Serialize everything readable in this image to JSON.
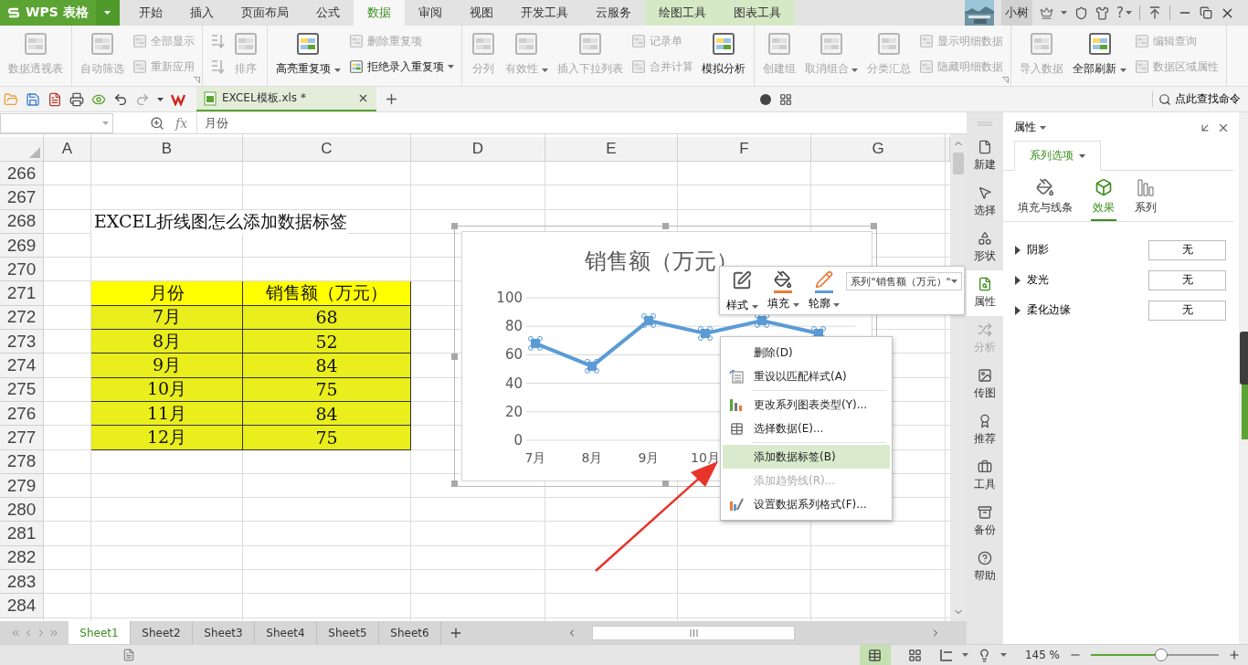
{
  "app_button": {
    "label": "WPS 表格"
  },
  "menu_tabs": [
    {
      "label": "开始",
      "selected": false,
      "kind": "main"
    },
    {
      "label": "插入",
      "selected": false,
      "kind": "main"
    },
    {
      "label": "页面布局",
      "selected": false,
      "kind": "main"
    },
    {
      "label": "公式",
      "selected": false,
      "kind": "main"
    },
    {
      "label": "数据",
      "selected": true,
      "kind": "main"
    },
    {
      "label": "审阅",
      "selected": false,
      "kind": "main"
    },
    {
      "label": "视图",
      "selected": false,
      "kind": "main"
    },
    {
      "label": "开发工具",
      "selected": false,
      "kind": "main"
    },
    {
      "label": "云服务",
      "selected": false,
      "kind": "main"
    },
    {
      "label": "绘图工具",
      "selected": false,
      "kind": "context"
    },
    {
      "label": "图表工具",
      "selected": false,
      "kind": "context"
    }
  ],
  "account": {
    "name": "小树",
    "help": "?"
  },
  "ribbon_groups": [
    {
      "launcher": false,
      "columns": [
        {
          "kind": "large",
          "label": "数据透视表",
          "disabled": true,
          "dropdown": false
        }
      ]
    },
    {
      "launcher": true,
      "columns": [
        {
          "kind": "large",
          "label": "自动筛选",
          "disabled": true,
          "dropdown": false
        },
        {
          "kind": "stack",
          "items": [
            {
              "label": "全部显示",
              "disabled": true,
              "dropdown": false
            },
            {
              "label": "重新应用",
              "disabled": true,
              "dropdown": false
            }
          ]
        }
      ]
    },
    {
      "launcher": false,
      "columns": [
        {
          "kind": "stack",
          "items": [
            {
              "disabled": true,
              "dropdown": false
            },
            {
              "disabled": true,
              "dropdown": false
            }
          ]
        },
        {
          "kind": "large",
          "label": "排序",
          "disabled": true,
          "dropdown": false
        }
      ]
    },
    {
      "launcher": false,
      "columns": [
        {
          "kind": "large",
          "label": "高亮重复项",
          "disabled": false,
          "dropdown": true
        },
        {
          "kind": "stack",
          "items": [
            {
              "label": "删除重复项",
              "disabled": true,
              "dropdown": false
            },
            {
              "label": "拒绝录入重复项",
              "disabled": false,
              "dropdown": true
            }
          ]
        }
      ]
    },
    {
      "launcher": false,
      "columns": [
        {
          "kind": "large",
          "label": "分列",
          "disabled": true,
          "dropdown": false
        },
        {
          "kind": "large",
          "label": "有效性",
          "disabled": true,
          "dropdown": true
        },
        {
          "kind": "large",
          "label": "插入下拉列表",
          "disabled": true,
          "dropdown": false
        },
        {
          "kind": "stack",
          "items": [
            {
              "label": "记录单",
              "disabled": true,
              "dropdown": false
            },
            {
              "label": "合并计算",
              "disabled": true,
              "dropdown": false
            }
          ]
        },
        {
          "kind": "large",
          "label": "模拟分析",
          "disabled": false,
          "dropdown": false
        }
      ]
    },
    {
      "launcher": true,
      "columns": [
        {
          "kind": "large",
          "label": "创建组",
          "disabled": true,
          "dropdown": false
        },
        {
          "kind": "large",
          "label": "取消组合",
          "disabled": true,
          "dropdown": true
        },
        {
          "kind": "large",
          "label": "分类汇总",
          "disabled": true,
          "dropdown": false
        },
        {
          "kind": "stack",
          "items": [
            {
              "label": "显示明细数据",
              "disabled": true,
              "dropdown": false
            },
            {
              "label": "隐藏明细数据",
              "disabled": true,
              "dropdown": false
            }
          ]
        }
      ]
    },
    {
      "launcher": false,
      "columns": [
        {
          "kind": "large",
          "label": "导入数据",
          "disabled": true,
          "dropdown": false
        },
        {
          "kind": "large",
          "label": "全部刷新",
          "disabled": false,
          "dropdown": true
        },
        {
          "kind": "stack",
          "items": [
            {
              "label": "编辑查询",
              "disabled": true,
              "dropdown": false
            },
            {
              "label": "数据区域属性",
              "disabled": true,
              "dropdown": false
            }
          ]
        }
      ]
    }
  ],
  "document_tab": {
    "title": "EXCEL模板.xls *"
  },
  "find_command": {
    "label": "点此查找命令"
  },
  "formula_bar": {
    "fx": "fx",
    "value": "月份"
  },
  "sheet": {
    "columns": [
      "A",
      "B",
      "C",
      "D",
      "E",
      "F",
      "G"
    ],
    "row_numbers": [
      "266",
      "267",
      "268",
      "269",
      "270",
      "271",
      "272",
      "273",
      "274",
      "275",
      "276",
      "277",
      "278",
      "279",
      "280",
      "281",
      "282",
      "283",
      "284"
    ],
    "note": "EXCEL折线图怎么添加数据标签",
    "table": {
      "header": [
        "月份",
        "销售额（万元）"
      ],
      "rows": [
        [
          "7月",
          "68"
        ],
        [
          "8月",
          "52"
        ],
        [
          "9月",
          "84"
        ],
        [
          "10月",
          "75"
        ],
        [
          "11月",
          "84"
        ],
        [
          "12月",
          "75"
        ]
      ]
    }
  },
  "chart": {
    "chart_data": {
      "type": "line",
      "title": "销售额（万元）",
      "categories": [
        "7月",
        "8月",
        "9月",
        "10月",
        null,
        null
      ],
      "series": [
        {
          "color": "#5b9bd5",
          "marker": "square",
          "values": [
            68,
            52,
            84,
            75,
            84,
            75
          ]
        }
      ],
      "ylim": [
        0,
        100
      ],
      "yticks": [
        0,
        20,
        40,
        60,
        80,
        100
      ],
      "grid": true
    }
  },
  "chart_toolbar": {
    "buttons": [
      {
        "label": "样式"
      },
      {
        "label": "填充"
      },
      {
        "label": "轮廓"
      }
    ],
    "series_select": "系列\"销售额（万元）\""
  },
  "context_menu": [
    {
      "kind": "item",
      "label": "删除(D)",
      "selected": false,
      "disabled": false
    },
    {
      "kind": "item",
      "label": "重设以匹配样式(A)",
      "selected": false,
      "disabled": false
    },
    {
      "kind": "separator"
    },
    {
      "kind": "item",
      "label": "更改系列图表类型(Y)...",
      "selected": false,
      "disabled": false
    },
    {
      "kind": "item",
      "label": "选择数据(E)...",
      "selected": false,
      "disabled": false
    },
    {
      "kind": "separator"
    },
    {
      "kind": "item",
      "label": "添加数据标签(B)",
      "selected": true,
      "disabled": false
    },
    {
      "kind": "item",
      "label": "添加趋势线(R)...",
      "selected": false,
      "disabled": true
    },
    {
      "kind": "item",
      "label": "设置数据系列格式(F)...",
      "selected": false,
      "disabled": false
    }
  ],
  "side_bar": [
    {
      "label": "新建",
      "selected": false,
      "disabled": false
    },
    {
      "label": "选择",
      "selected": false,
      "disabled": false
    },
    {
      "label": "形状",
      "selected": false,
      "disabled": false
    },
    {
      "label": "属性",
      "selected": true,
      "disabled": false
    },
    {
      "label": "分析",
      "selected": false,
      "disabled": true
    },
    {
      "label": "传图",
      "selected": false,
      "disabled": false
    },
    {
      "label": "推荐",
      "selected": false,
      "disabled": false
    },
    {
      "label": "工具",
      "selected": false,
      "disabled": false
    },
    {
      "label": "备份",
      "selected": false,
      "disabled": false
    },
    {
      "label": "帮助",
      "selected": false,
      "disabled": false
    }
  ],
  "properties_panel": {
    "title": "属性",
    "tab": "系列选项",
    "subtabs": [
      {
        "label": "填充与线条",
        "selected": false
      },
      {
        "label": "效果",
        "selected": true
      },
      {
        "label": "系列",
        "selected": false
      }
    ],
    "effects": [
      {
        "label": "阴影",
        "value": "无",
        "expanded": false
      },
      {
        "label": "发光",
        "value": "无",
        "expanded": false
      },
      {
        "label": "柔化边缘",
        "value": "无",
        "expanded": false
      }
    ]
  },
  "sheet_tabs": [
    {
      "label": "Sheet1",
      "selected": true
    },
    {
      "label": "Sheet2",
      "selected": false
    },
    {
      "label": "Sheet3",
      "selected": false
    },
    {
      "label": "Sheet4",
      "selected": false
    },
    {
      "label": "Sheet5",
      "selected": false
    },
    {
      "label": "Sheet6",
      "selected": false
    }
  ],
  "status_bar": {
    "view_buttons": [
      {
        "selected": true
      },
      {
        "selected": false
      }
    ],
    "zoom": "145 %",
    "zoom_slider": {
      "level": 0.55
    }
  }
}
